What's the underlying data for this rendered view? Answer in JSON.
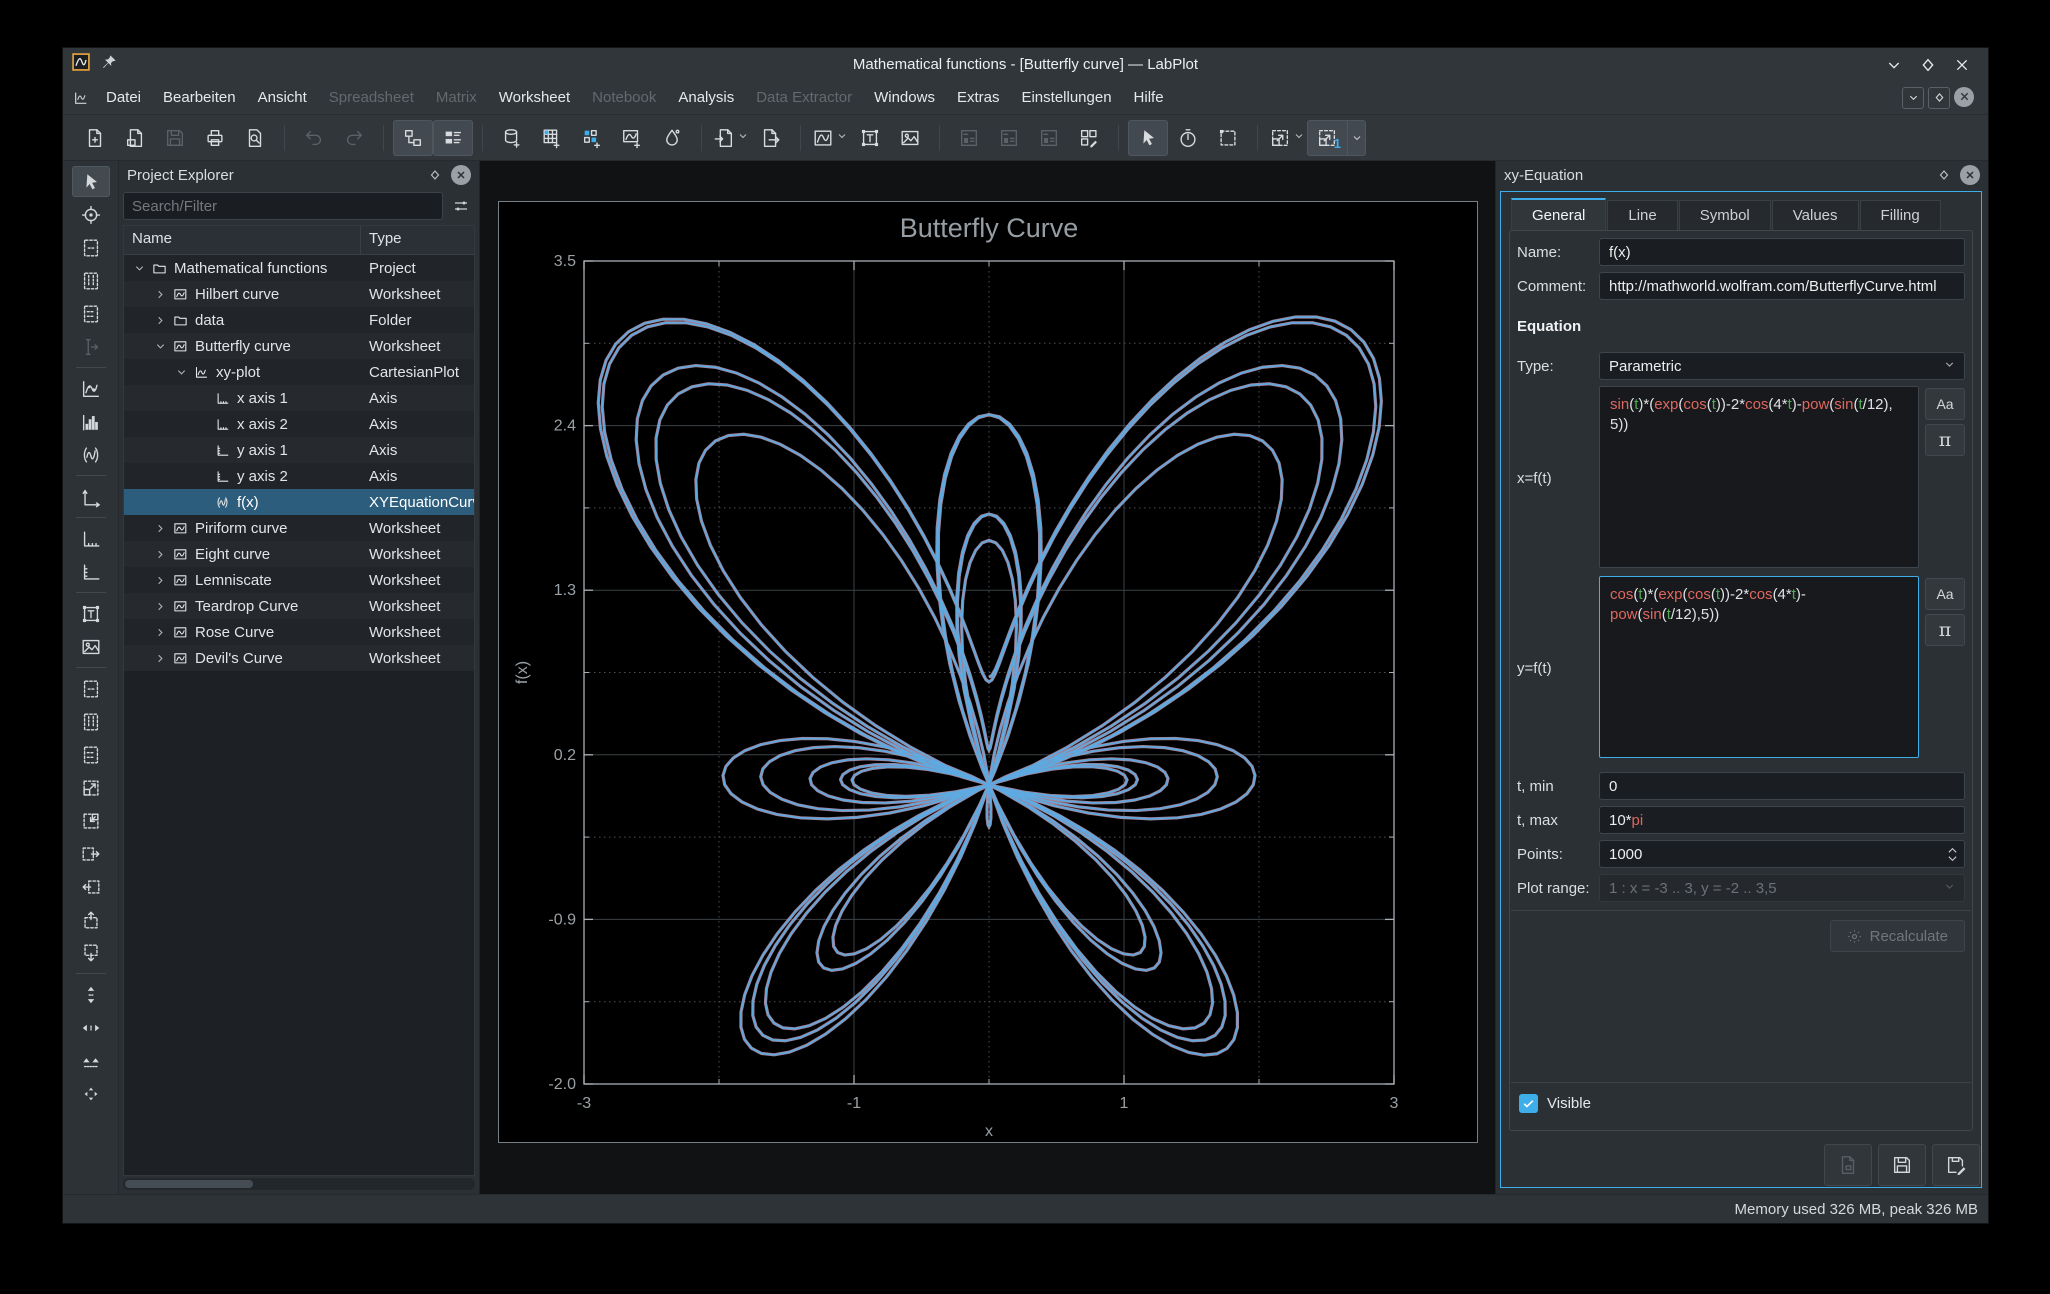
{
  "colors": {
    "accent": "#3daee9",
    "curve": "#5ea9e0",
    "curve_halo": "#d9aac4",
    "function_color": "#e0675f",
    "variable_color": "#4fae55",
    "selection": "#2d5d7c"
  },
  "window": {
    "title": "Mathematical functions - [Butterfly curve] — LabPlot",
    "controls": [
      {
        "name": "minimize-button",
        "icon": "chevron-down"
      },
      {
        "name": "maximize-button",
        "icon": "diamond"
      },
      {
        "name": "close-button",
        "icon": "close-x"
      }
    ]
  },
  "menubar": {
    "items": [
      {
        "label": "Datei",
        "enabled": true
      },
      {
        "label": "Bearbeiten",
        "enabled": true
      },
      {
        "label": "Ansicht",
        "enabled": true
      },
      {
        "label": "Spreadsheet",
        "enabled": false
      },
      {
        "label": "Matrix",
        "enabled": false
      },
      {
        "label": "Worksheet",
        "enabled": true
      },
      {
        "label": "Notebook",
        "enabled": false
      },
      {
        "label": "Analysis",
        "enabled": true
      },
      {
        "label": "Data Extractor",
        "enabled": false
      },
      {
        "label": "Windows",
        "enabled": true
      },
      {
        "label": "Extras",
        "enabled": true
      },
      {
        "label": "Einstellungen",
        "enabled": true
      },
      {
        "label": "Hilfe",
        "enabled": true
      }
    ]
  },
  "toolbar": {
    "groups": [
      [
        {
          "name": "new-project-button",
          "icon": "doc-new"
        },
        {
          "name": "open-project-button",
          "icon": "doc-open"
        },
        {
          "name": "save-project-button",
          "icon": "save",
          "disabled": true
        },
        {
          "name": "print-button",
          "icon": "print"
        },
        {
          "name": "print-preview-button",
          "icon": "print-preview"
        }
      ],
      [
        {
          "name": "undo-button",
          "icon": "undo",
          "disabled": true
        },
        {
          "name": "redo-button",
          "icon": "redo",
          "disabled": true
        }
      ],
      [
        {
          "name": "toggle-project-explorer-button",
          "icon": "panel-tree",
          "checked": true
        },
        {
          "name": "toggle-properties-explorer-button",
          "icon": "panel-props",
          "checked": true
        }
      ],
      [
        {
          "name": "new-workbook-button",
          "icon": "workbook"
        },
        {
          "name": "new-spreadsheet-button",
          "icon": "spreadsheet"
        },
        {
          "name": "new-matrix-button",
          "icon": "matrix"
        },
        {
          "name": "new-worksheet-button",
          "icon": "worksheet-new"
        },
        {
          "name": "new-notebook-button",
          "icon": "notebook"
        }
      ],
      [
        {
          "name": "import-button",
          "icon": "import",
          "chevron": true
        },
        {
          "name": "export-button",
          "icon": "export"
        }
      ],
      [
        {
          "name": "new-plot-button",
          "icon": "plot-new",
          "chevron": true
        },
        {
          "name": "add-text-label-button",
          "icon": "text-label"
        },
        {
          "name": "add-image-button",
          "icon": "image"
        }
      ],
      [
        {
          "name": "vertical-layout-button",
          "icon": "layout",
          "disabled": true
        },
        {
          "name": "horizontal-layout-button",
          "icon": "layout",
          "disabled": true
        },
        {
          "name": "grid-layout-button",
          "icon": "layout",
          "disabled": true
        },
        {
          "name": "edit-layout-button",
          "icon": "edit-layout"
        }
      ],
      [
        {
          "name": "select-mode-button",
          "icon": "pointer",
          "checked": true
        },
        {
          "name": "navigate-mode-button",
          "icon": "stopwatch"
        },
        {
          "name": "zoom-select-mode-button",
          "icon": "select-box"
        }
      ],
      [
        {
          "name": "auto-fit-button",
          "icon": "fit-arrow",
          "chevron": true
        },
        {
          "name": "fit-selection-button",
          "icon": "fit-arrow",
          "badge": "1",
          "checked": true,
          "split": true
        }
      ]
    ]
  },
  "left_toolbar": {
    "groups": [
      [
        {
          "name": "select-mode-button",
          "icon": "pointer",
          "checked": true
        },
        {
          "name": "crosshair-mode-button",
          "icon": "target"
        },
        {
          "name": "zoom-select-region-button",
          "icon": "region"
        },
        {
          "name": "zoom-select-x-region-button",
          "icon": "region-x"
        },
        {
          "name": "zoom-select-y-region-button",
          "icon": "region-y"
        },
        {
          "name": "cursor-tool-button",
          "icon": "cursor-line",
          "disabled": true
        }
      ],
      [
        {
          "name": "add-xy-curve-button",
          "icon": "xy-curve"
        },
        {
          "name": "add-histogram-button",
          "icon": "histogram"
        },
        {
          "name": "add-equation-curve-button",
          "icon": "equation"
        }
      ],
      [
        {
          "name": "add-axis-button",
          "icon": "axis"
        }
      ],
      [
        {
          "name": "add-horizontal-axis-button",
          "icon": "axis-x"
        },
        {
          "name": "add-vertical-axis-button",
          "icon": "axis-y"
        }
      ],
      [
        {
          "name": "add-text-label-button",
          "icon": "text-label"
        },
        {
          "name": "add-image-button",
          "icon": "image"
        }
      ],
      [
        {
          "name": "zoom-region-button",
          "icon": "region"
        },
        {
          "name": "zoom-x-region-button",
          "icon": "region-x"
        },
        {
          "name": "zoom-y-region-button",
          "icon": "region-y"
        },
        {
          "name": "zoom-in-button",
          "icon": "zoom-in-box"
        },
        {
          "name": "zoom-out-button",
          "icon": "zoom-out-box"
        },
        {
          "name": "shift-right-button",
          "icon": "shift-right"
        },
        {
          "name": "shift-left-button",
          "icon": "shift-left"
        },
        {
          "name": "shift-up-button",
          "icon": "shift-up"
        },
        {
          "name": "shift-down-button",
          "icon": "shift-down"
        }
      ],
      [
        {
          "name": "auto-scale-y-button",
          "icon": "arrows-v"
        },
        {
          "name": "auto-scale-x-button",
          "icon": "arrows-h"
        },
        {
          "name": "auto-scale-button",
          "icon": "arrows-down"
        },
        {
          "name": "auto-scale-all-button",
          "icon": "arrows-all"
        }
      ]
    ]
  },
  "project_explorer": {
    "title": "Project Explorer",
    "search_placeholder": "Search/Filter",
    "columns": [
      "Name",
      "Type"
    ],
    "rows": [
      {
        "name": "Mathematical functions",
        "type": "Project",
        "depth": 0,
        "state": "expanded",
        "icon": "folder"
      },
      {
        "name": "Hilbert curve",
        "type": "Worksheet",
        "depth": 1,
        "state": "collapsed",
        "icon": "worksheet"
      },
      {
        "name": "data",
        "type": "Folder",
        "depth": 1,
        "state": "collapsed",
        "icon": "folder"
      },
      {
        "name": "Butterfly curve",
        "type": "Worksheet",
        "depth": 1,
        "state": "expanded",
        "icon": "worksheet"
      },
      {
        "name": "xy-plot",
        "type": "CartesianPlot",
        "depth": 2,
        "state": "expanded",
        "icon": "plot"
      },
      {
        "name": "x axis 1",
        "type": "Axis",
        "depth": 3,
        "state": "leaf",
        "icon": "axis-x"
      },
      {
        "name": "x axis 2",
        "type": "Axis",
        "depth": 3,
        "state": "leaf",
        "icon": "axis-x"
      },
      {
        "name": "y axis 1",
        "type": "Axis",
        "depth": 3,
        "state": "leaf",
        "icon": "axis-y"
      },
      {
        "name": "y axis 2",
        "type": "Axis",
        "depth": 3,
        "state": "leaf",
        "icon": "axis-y"
      },
      {
        "name": "f(x)",
        "type": "XYEquationCurve",
        "depth": 3,
        "state": "leaf",
        "icon": "equation",
        "selected": true
      },
      {
        "name": "Piriform curve",
        "type": "Worksheet",
        "depth": 1,
        "state": "collapsed",
        "icon": "worksheet"
      },
      {
        "name": "Eight curve",
        "type": "Worksheet",
        "depth": 1,
        "state": "collapsed",
        "icon": "worksheet"
      },
      {
        "name": "Lemniscate",
        "type": "Worksheet",
        "depth": 1,
        "state": "collapsed",
        "icon": "worksheet"
      },
      {
        "name": "Teardrop Curve",
        "type": "Worksheet",
        "depth": 1,
        "state": "collapsed",
        "icon": "worksheet"
      },
      {
        "name": "Rose Curve",
        "type": "Worksheet",
        "depth": 1,
        "state": "collapsed",
        "icon": "worksheet"
      },
      {
        "name": "Devil's Curve",
        "type": "Worksheet",
        "depth": 1,
        "state": "collapsed",
        "icon": "worksheet"
      }
    ]
  },
  "chart_data": {
    "type": "line",
    "title": "Butterfly Curve",
    "xlabel": "x",
    "ylabel": "f(x)",
    "xlim": [
      -3,
      3
    ],
    "ylim": [
      -2.0,
      3.5
    ],
    "x_major_ticks": [
      -3,
      -1,
      1,
      3
    ],
    "x_minor_ticks": [
      -2,
      0,
      2
    ],
    "y_major_ticks": [
      3.5,
      2.4,
      1.3,
      0.2,
      -0.9,
      -2.0
    ],
    "y_minor_ticks": [
      2.95,
      1.85,
      0.75,
      -0.35,
      -1.45
    ],
    "grid": {
      "major": "solid",
      "minor": "dotted"
    },
    "legend": "none",
    "series": [
      {
        "name": "f(x)",
        "kind": "parametric",
        "x_t": "sin(t)*(exp(cos(t))-2*cos(4*t)-pow(sin(t/12), 5))",
        "y_t": "cos(t)*(exp(cos(t))-2*cos(4*t)-pow(sin(t/12),5))",
        "t_min": 0,
        "t_max": "10*pi",
        "points": 1000,
        "color": "#5ea9e0"
      }
    ]
  },
  "properties": {
    "title": "xy-Equation",
    "tabs": [
      "General",
      "Line",
      "Symbol",
      "Values",
      "Filling"
    ],
    "active_tab": "General",
    "fields": {
      "name_label": "Name:",
      "name_value": "f(x)",
      "comment_label": "Comment:",
      "comment_value": "http://mathworld.wolfram.com/ButterflyCurve.html",
      "section_title": "Equation",
      "type_label": "Type:",
      "type_value": "Parametric",
      "x_label": "x=f(t)",
      "x_equation": "sin(t)*(exp(cos(t))-2*cos(4*t)-pow(sin(t/12), 5))",
      "y_label": "y=f(t)",
      "y_equation": "cos(t)*(exp(cos(t))-2*cos(4*t)-pow(sin(t/12),5))",
      "tmin_label": "t, min",
      "tmin_value": "0",
      "tmax_label": "t, max",
      "tmax_value": "10*pi",
      "points_label": "Points:",
      "points_value": "1000",
      "plot_range_label": "Plot range:",
      "plot_range_value": "1 : x = -3 .. 3, y = -2 .. 3,5",
      "recalculate_label": "Recalculate",
      "visible_label": "Visible",
      "visible_checked": true,
      "constants_button": "Aa",
      "functions_button": "π"
    }
  },
  "statusbar": {
    "memory": "Memory used 326 MB, peak 326 MB"
  }
}
